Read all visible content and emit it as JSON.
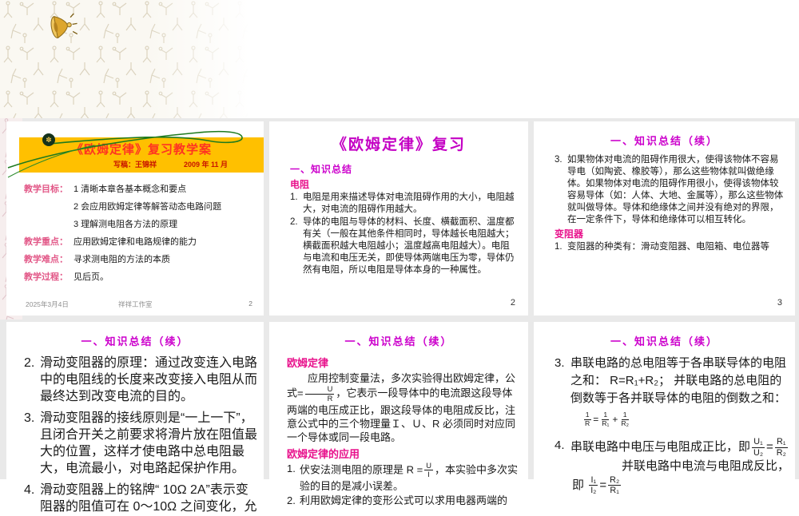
{
  "decor": {
    "speaker_icon": "speaker-horn-icon",
    "medallion_glyph": "✽"
  },
  "slide1": {
    "banner_title": "《欧姆定律》复习教学案",
    "byline": "写稿：王锦祥",
    "byline_date": "2009 年 11 月",
    "rows": [
      {
        "label": "教学目标：",
        "lines": [
          "1 清晰本章各基本概念和要点",
          "2 会应用欧姆定律等解答动态电路问题",
          "3 理解测电阻各方法的原理"
        ]
      },
      {
        "label": "教学重点：",
        "lines": [
          "应用欧姆定律和电路规律的能力"
        ]
      },
      {
        "label": "教学难点：",
        "lines": [
          "寻求测电阻的方法的本质"
        ]
      },
      {
        "label": "教学过程：",
        "lines": [
          "见后页。"
        ]
      }
    ],
    "footer_date": "2025年3月4日",
    "footer_studio": "祥祥工作室",
    "page_number": "2"
  },
  "slide2": {
    "title": "《欧姆定律》复习",
    "section": "一、知识总结",
    "heading": "电阻",
    "items": [
      {
        "num": "1.",
        "text": "电阻是用来描述导体对电流阻碍作用的大小，电阻越大，对电流的阻碍作用越大。"
      },
      {
        "num": "2.",
        "text": "导体的电阻与导体的材料、长度、横截面积、温度都有关（一般在其他条件相同时，导体越长电阻越大；横截面积越大电阻越小；温度越高电阻越大）。电阻与电流和电压无关，即使导体两端电压为零，导体仍然有电阻，所以电阻是导体本身的一种属性。"
      }
    ],
    "page_number": "2"
  },
  "slide3": {
    "title": "一、知识总结（续）",
    "item3_num": "3.",
    "item3_text": "如果物体对电流的阻碍作用很大，使得该物体不容易导电（如陶瓷、橡胶等），那么这些物体就叫做绝缘体。如果物体对电流的阻碍作用很小，使得该物体较容易导体（如：人体、大地、金属等），那么这些物体就叫做导体。导体和绝缘体之间并没有绝对的界限，在一定条件下，导体和绝缘体可以相互转化。",
    "heading": "变阻器",
    "item1_num": "1.",
    "item1_text": "变阻器的种类有：滑动变阻器、电阻箱、电位器等",
    "page_number": "3"
  },
  "slide4": {
    "title": "一、知识总结（续）",
    "items": [
      {
        "num": "2.",
        "text": "滑动变阻器的原理：通过改变连入电路中的电阻线的长度来改变接入电阻从而最终达到改变电流的目的。"
      },
      {
        "num": "3.",
        "text": "滑动变阻器的接线原则是“一上一下”，且闭合开关之前要求将滑片放在阻值最大的位置，这样才使电路中总电阻最大，电流最小，对电路起保护作用。"
      },
      {
        "num": "4.",
        "text": "滑动变阻器上的铭牌“ 10Ω 2A”表示变阻器的阻值可在 0～10Ω 之间变化，允"
      }
    ]
  },
  "slide5": {
    "title": "一、知识总结（续）",
    "heading1": "欧姆定律",
    "para_before": "应用控制变量法，多次实验得出欧姆定律，公式=",
    "frac1": {
      "num": "U",
      "den": "R"
    },
    "para_after": "，它表示一段导体中的电流跟这段导体两端的电压成正比，跟这段导体的电阻成反比，注意公式中的三个物理量Ｉ、Ｕ、R 必须同时对应同一个导体或同一段电路。",
    "heading2": "欧姆定律的应用",
    "item1_num": "1.",
    "item1_before": "伏安法测电阻的原理是 R =",
    "frac2": {
      "num": "U",
      "den": "I"
    },
    "item1_after": "，本实验中多次实验的目的是减小误差。",
    "item2_num": "2.",
    "item2_text": "利用欧姆定律的变形公式可以求用电器两端的"
  },
  "slide6": {
    "title": "一、知识总结（续）",
    "item3_num": "3.",
    "item3_text": "串联电路的总电阻等于各串联导体的电阻之和： R=R₁+R₂； 并联电路的总电阻的倒数等于各并联导体的电阻的倒数之和：",
    "formula3": {
      "lnum": "1",
      "lden": "R",
      "eq": "=",
      "t1num": "1",
      "t1den": "R₁",
      "plus": "+",
      "t2num": "1",
      "t2den": "R₂"
    },
    "item4_num": "4.",
    "item4_text1": "串联电路中电压与电阻成正比，即",
    "formula4a": {
      "lnum": "U₁",
      "lden": "U₂",
      "eq": "=",
      "rnum": "R₁",
      "rden": "R₂"
    },
    "item4_text2": "并联电路中电流与电阻成反比，",
    "item4_text3": "即",
    "formula4b": {
      "lnum": "I₁",
      "lden": "I₂",
      "eq": "=",
      "rnum": "R₂",
      "rden": "R₁"
    }
  }
}
